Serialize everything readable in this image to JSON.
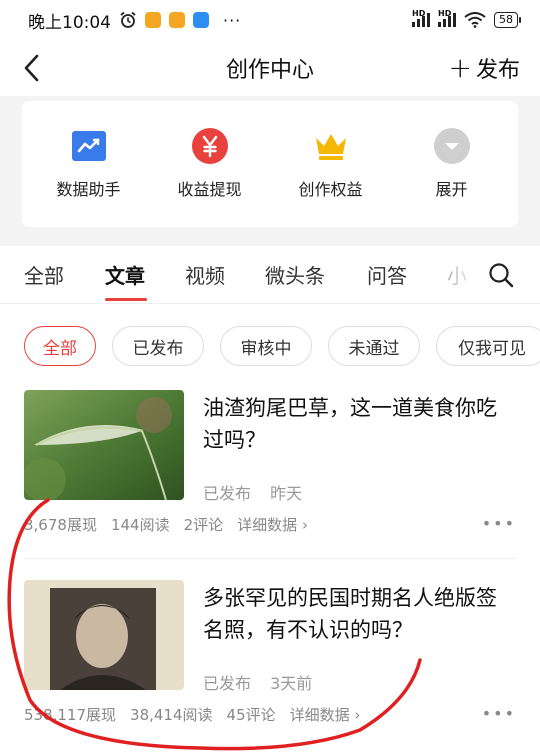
{
  "status_bar": {
    "time": "晚上10:04",
    "battery": "58"
  },
  "header": {
    "title": "创作中心",
    "publish_label": "发布"
  },
  "tools": [
    {
      "label": "数据助手",
      "icon": "chart-icon"
    },
    {
      "label": "收益提现",
      "icon": "yuan-icon"
    },
    {
      "label": "创作权益",
      "icon": "crown-icon"
    },
    {
      "label": "展开",
      "icon": "chevron-down-icon"
    }
  ],
  "tabs": [
    {
      "label": "全部"
    },
    {
      "label": "文章",
      "active": true
    },
    {
      "label": "视频"
    },
    {
      "label": "微头条"
    },
    {
      "label": "问答"
    },
    {
      "label": "小"
    }
  ],
  "filters": [
    {
      "label": "全部",
      "active": true
    },
    {
      "label": "已发布"
    },
    {
      "label": "审核中"
    },
    {
      "label": "未通过"
    },
    {
      "label": "仅我可见"
    }
  ],
  "articles": [
    {
      "title": "油渣狗尾巴草，这一道美食你吃过吗？",
      "status": "已发布",
      "time": "昨天",
      "views": "3,678展现",
      "reads": "144阅读",
      "comments": "2评论",
      "detail": "详细数据"
    },
    {
      "title": "多张罕见的民国时期名人绝版签名照，有不认识的吗？",
      "status": "已发布",
      "time": "3天前",
      "views": "538,117展现",
      "reads": "38,414阅读",
      "comments": "45评论",
      "detail": "详细数据"
    }
  ],
  "colors": {
    "accent": "#e8413e",
    "chart_icon": "#3a7bea",
    "crown_icon": "#f5b800"
  }
}
